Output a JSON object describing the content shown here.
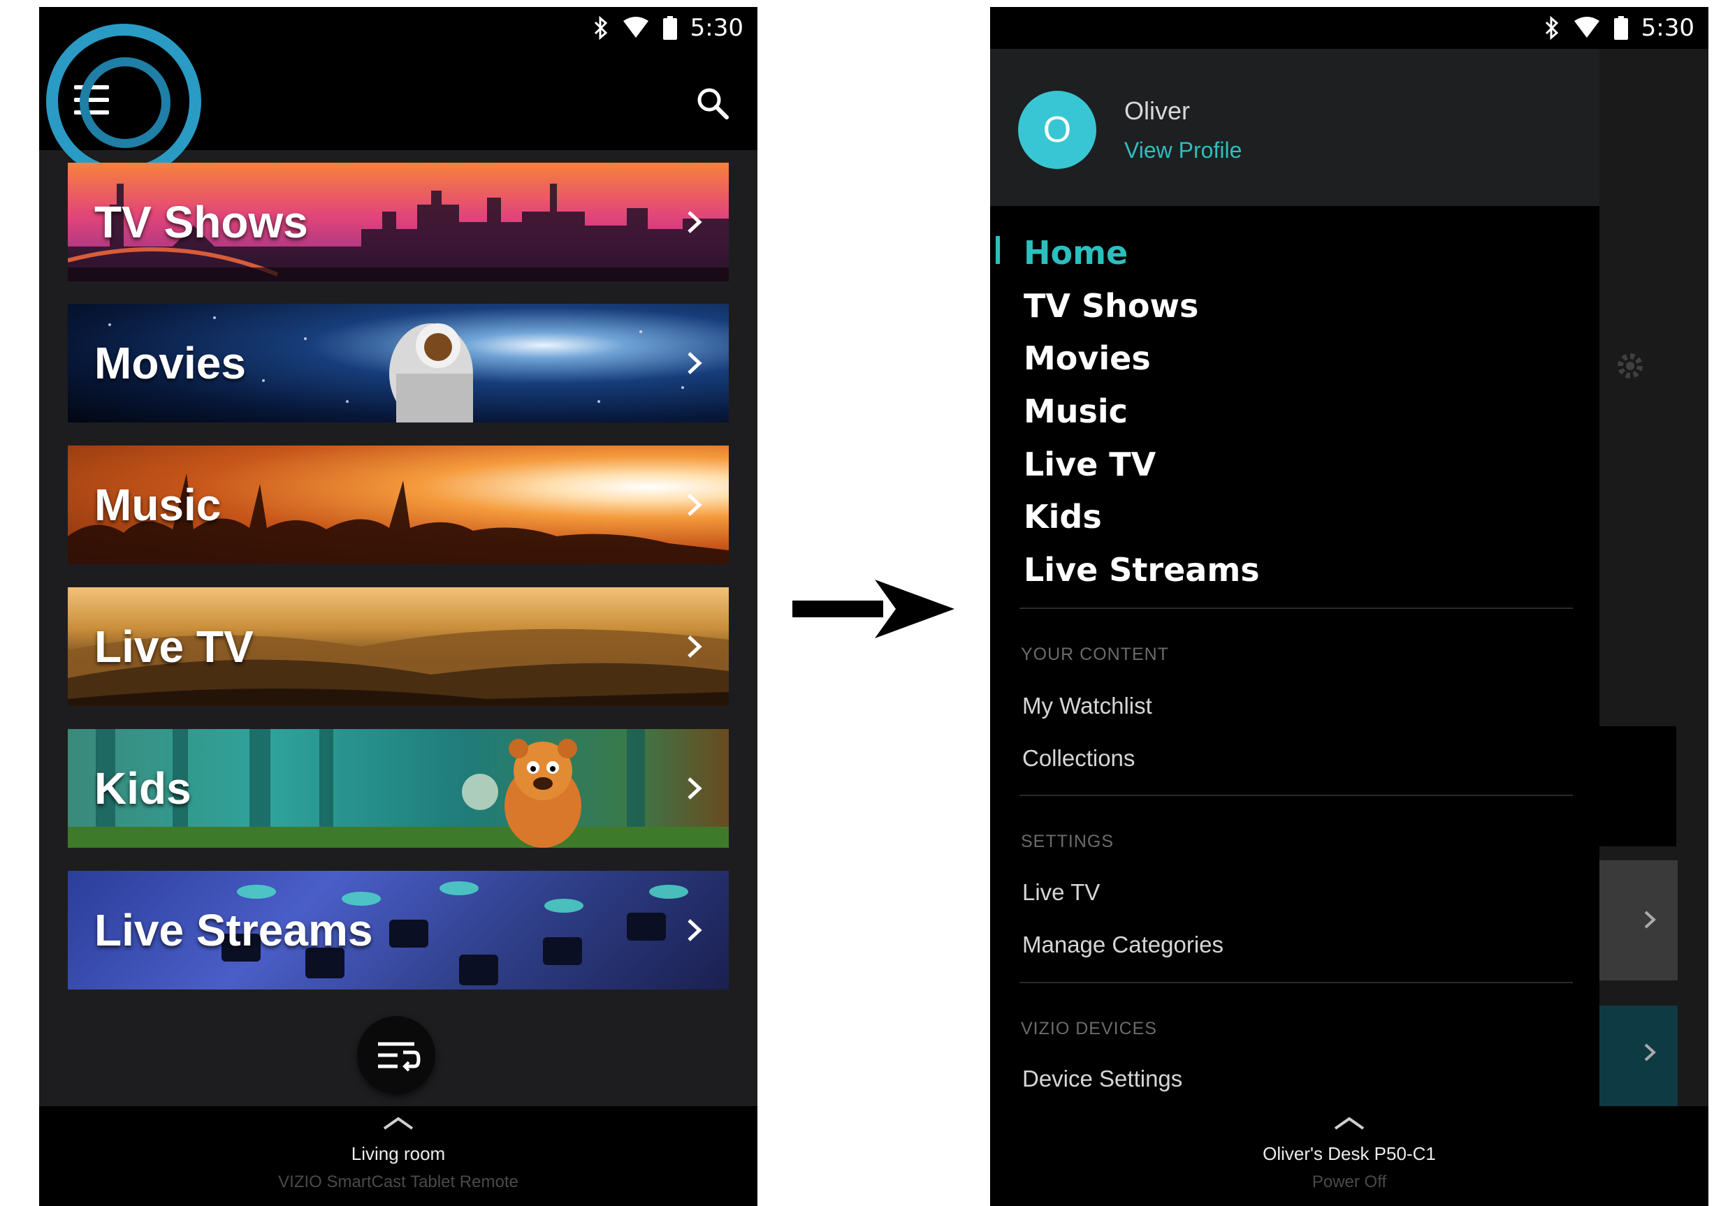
{
  "status_bar": {
    "time": "5:30"
  },
  "left_screen": {
    "categories": [
      {
        "label": "TV Shows"
      },
      {
        "label": "Movies"
      },
      {
        "label": "Music"
      },
      {
        "label": "Live TV"
      },
      {
        "label": "Kids"
      },
      {
        "label": "Live Streams"
      }
    ],
    "device_bar": {
      "device_name": "Living room",
      "subtitle": "VIZIO SmartCast Tablet Remote"
    }
  },
  "right_screen": {
    "profile": {
      "avatar_initial": "O",
      "name": "Oliver",
      "link": "View Profile"
    },
    "nav": [
      {
        "label": "Home",
        "active": true
      },
      {
        "label": "TV Shows"
      },
      {
        "label": "Movies"
      },
      {
        "label": "Music"
      },
      {
        "label": "Live TV"
      },
      {
        "label": "Kids"
      },
      {
        "label": "Live Streams"
      }
    ],
    "sections": [
      {
        "header": "YOUR CONTENT",
        "items": [
          "My Watchlist",
          "Collections"
        ]
      },
      {
        "header": "SETTINGS",
        "items": [
          "Live TV",
          "Manage Categories"
        ]
      },
      {
        "header": "VIZIO DEVICES",
        "items": [
          "Device Settings"
        ]
      }
    ],
    "device_bar": {
      "device_name": "Oliver's Desk P50-C1",
      "subtitle": "Power Off"
    }
  },
  "colors": {
    "accent_teal": "#2dbfbf",
    "avatar": "#38c6d4",
    "highlight_ring": "#2a9bc4"
  }
}
